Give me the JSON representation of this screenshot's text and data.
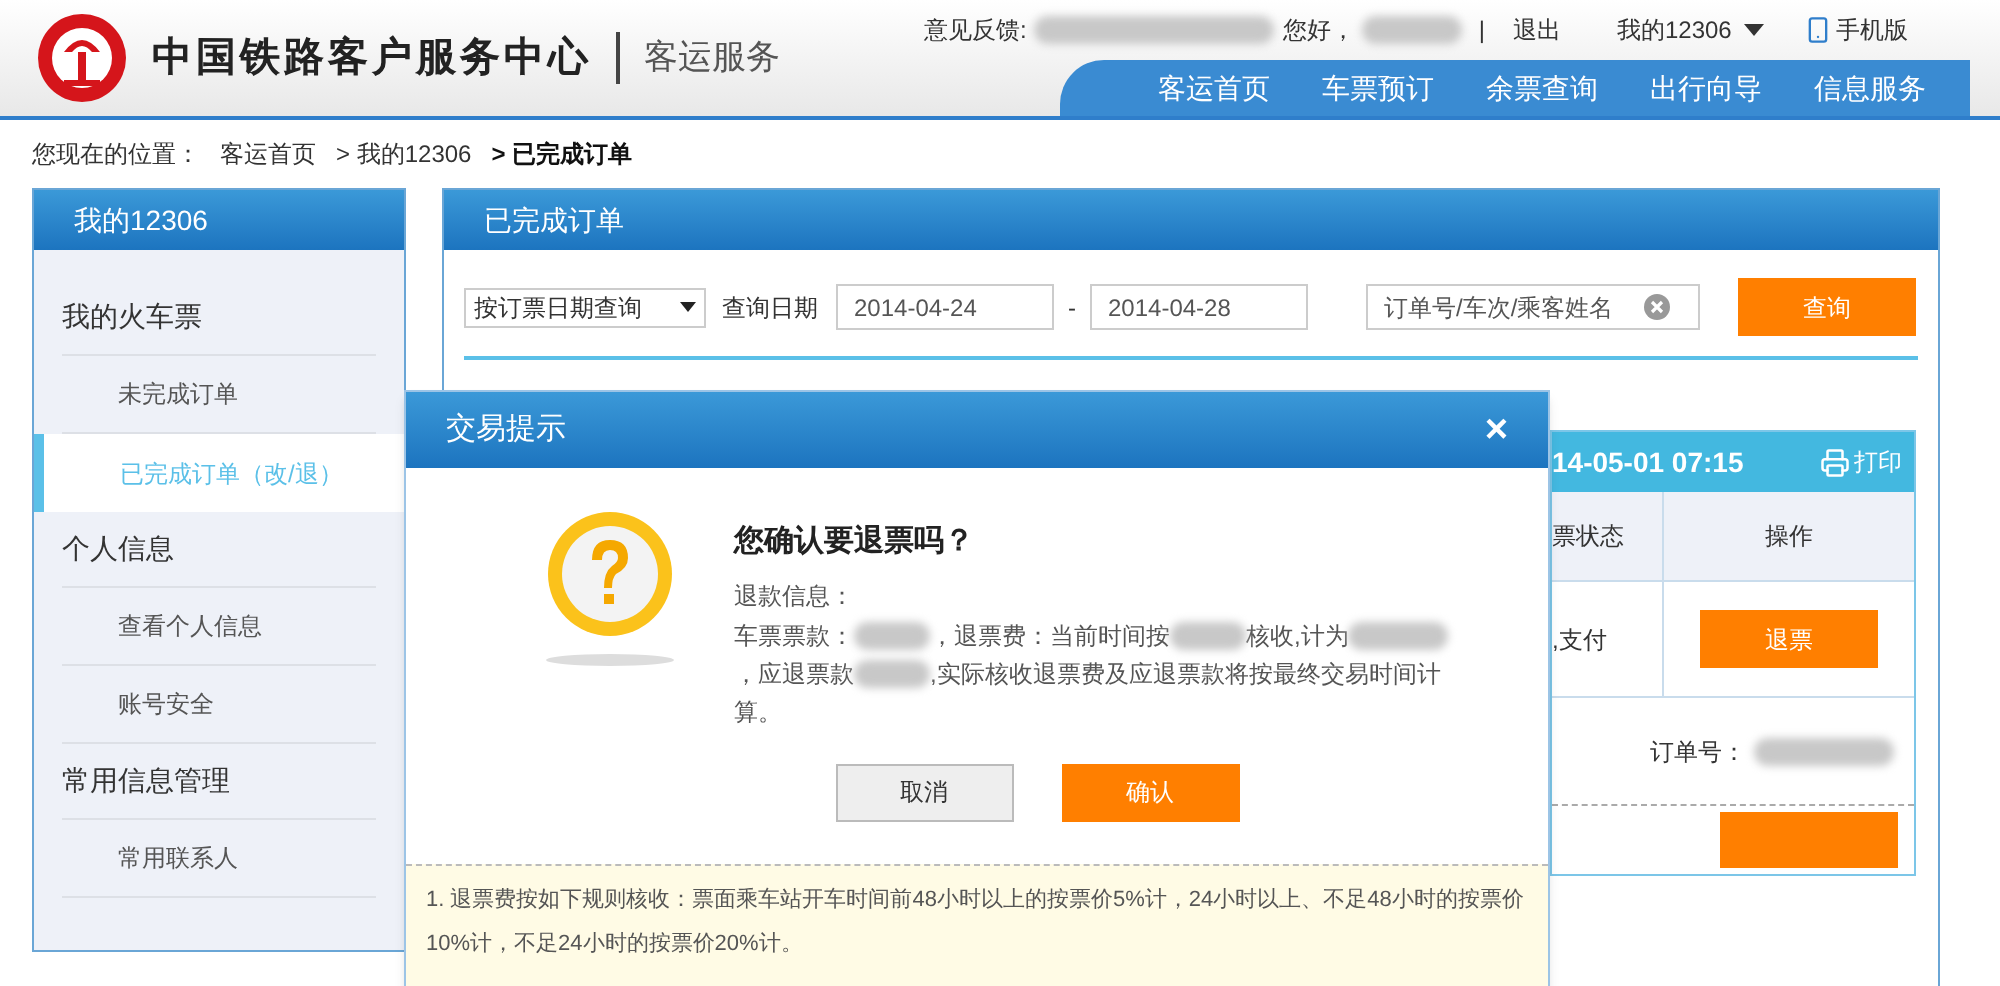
{
  "header": {
    "logo_title": "中国铁路客户服务中心",
    "subtitle": "客运服务",
    "feedback_label": "意见反馈:",
    "greeting": "您好，",
    "separator": "|",
    "logout": "退出",
    "account_menu": "我的12306",
    "mobile": "手机版"
  },
  "nav": [
    {
      "label": "客运首页"
    },
    {
      "label": "车票预订"
    },
    {
      "label": "余票查询"
    },
    {
      "label": "出行向导"
    },
    {
      "label": "信息服务"
    }
  ],
  "breadcrumb": {
    "prefix": "您现在的位置：",
    "items": [
      {
        "label": "客运首页",
        "current": false
      },
      {
        "label": "> 我的12306",
        "current": false
      },
      {
        "label": "> 已完成订单",
        "current": true
      }
    ]
  },
  "sidebar": {
    "title": "我的12306",
    "groups": [
      {
        "label": "我的火车票",
        "items": [
          {
            "label": "未完成订单",
            "selected": false
          },
          {
            "label": "已完成订单（改/退）",
            "selected": true
          }
        ]
      },
      {
        "label": "个人信息",
        "items": [
          {
            "label": "查看个人信息",
            "selected": false
          },
          {
            "label": "账号安全",
            "selected": false
          }
        ]
      },
      {
        "label": "常用信息管理",
        "items": [
          {
            "label": "常用联系人",
            "selected": false
          }
        ]
      }
    ]
  },
  "main": {
    "title": "已完成订单",
    "query_type": "按订票日期查询",
    "date_label": "查询日期",
    "date_from": "2014-04-24",
    "date_sep": "-",
    "date_to": "2014-04-28",
    "search_placeholder": "订单号/车次/乘客姓名",
    "search_button": "查询",
    "order": {
      "time": "14-05-01 07:15",
      "print": "打印",
      "columns": [
        "票状态",
        "操作"
      ],
      "status": ",支付",
      "refund_button": "退票",
      "order_no_label": "订单号："
    }
  },
  "dialog": {
    "title": "交易提示",
    "close": "×",
    "question": "您确认要退票吗？",
    "info_label": "退款信息：",
    "refund_parts": [
      "车票票款：",
      "，退票费：当前时间按",
      "核收,计为",
      "，应退票款",
      ",实际核收退票费及应退票款将按最终交易时间计算。"
    ],
    "cancel": "取消",
    "confirm": "确认",
    "notes": [
      "1. 退票费按如下规则核收：票面乘车站开车时间前48小时以上的按票价5%计，24小时以上、不足48小时的按票价10%计，不足24小时的按票价20%计。"
    ]
  }
}
